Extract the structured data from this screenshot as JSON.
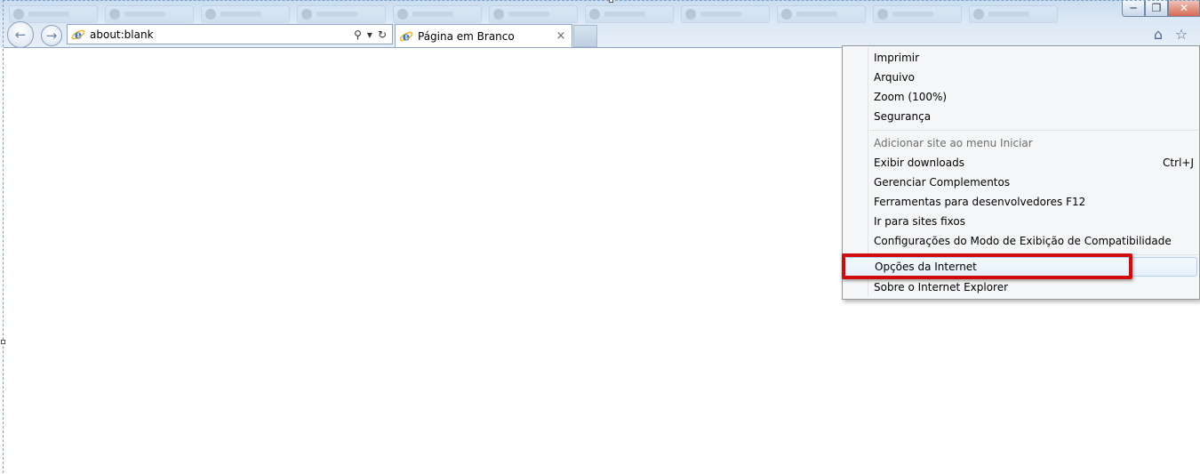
{
  "browser": {
    "address": "about:blank",
    "tab_title": "Página em Branco",
    "tab_close_glyph": "×",
    "window_controls": {
      "minimize": "─",
      "maximize": "❐",
      "close": "✕"
    },
    "toolbar_icons": [
      "home-icon",
      "favorites-star-icon"
    ]
  },
  "menu": {
    "items": [
      {
        "label": "Imprimir",
        "shortcut": "",
        "disabled": false
      },
      {
        "label": "Arquivo",
        "shortcut": "",
        "disabled": false
      },
      {
        "label": "Zoom (100%)",
        "shortcut": "",
        "disabled": false
      },
      {
        "label": "Segurança",
        "shortcut": "",
        "disabled": false
      },
      {
        "label": "Adicionar site ao menu Iniciar",
        "shortcut": "",
        "disabled": true
      },
      {
        "label": "Exibir downloads",
        "shortcut": "Ctrl+J",
        "disabled": false
      },
      {
        "label": "Gerenciar Complementos",
        "shortcut": "",
        "disabled": false
      },
      {
        "label": "Ferramentas para desenvolvedores F12",
        "shortcut": "",
        "disabled": false
      },
      {
        "label": "Ir para sites fixos",
        "shortcut": "",
        "disabled": false
      },
      {
        "label": "Configurações do Modo de Exibição de Compatibilidade",
        "shortcut": "",
        "disabled": false
      },
      {
        "label": "Opções da Internet",
        "shortcut": "",
        "disabled": false,
        "highlighted": true
      },
      {
        "label": "Sobre o Internet Explorer",
        "shortcut": "",
        "disabled": false
      }
    ]
  },
  "colors": {
    "highlight_border": "#d10a0a",
    "menu_background": "#f5f6f7",
    "chrome_blue": "#c9dcef"
  }
}
